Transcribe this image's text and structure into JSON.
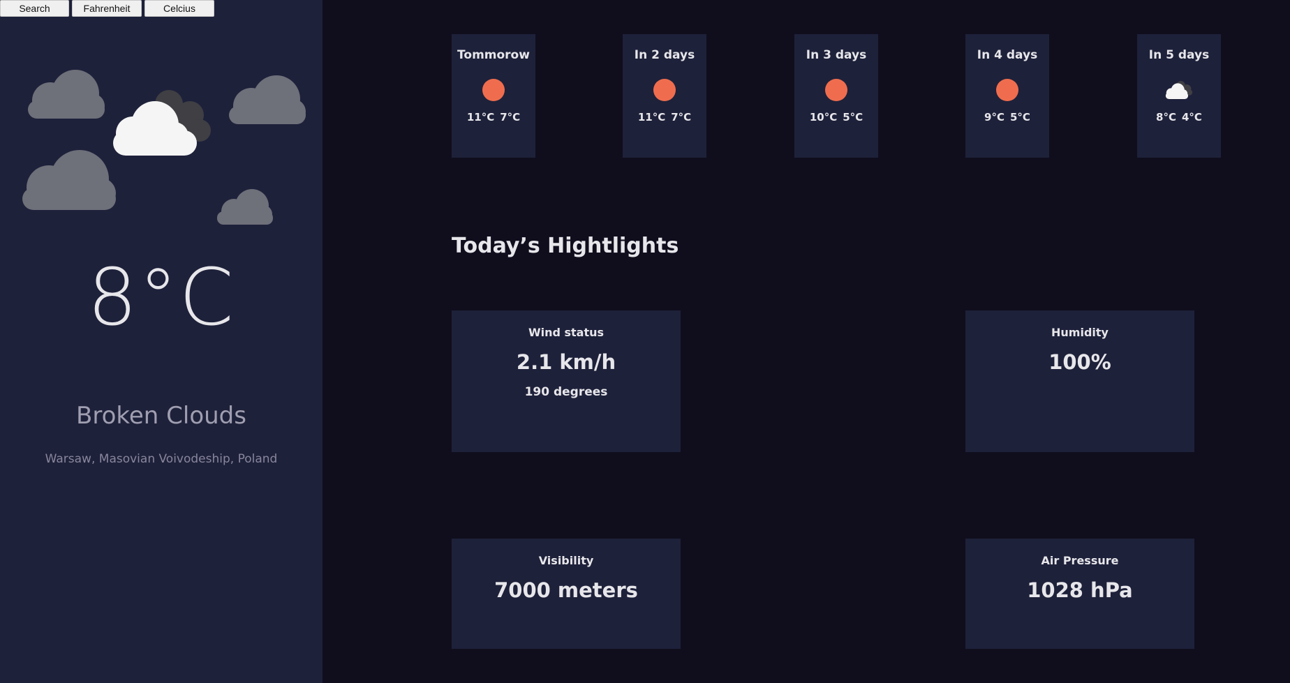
{
  "toolbar": {
    "search_label": "Search",
    "fahrenheit_label": "Fahrenheit",
    "celsius_label": "Celcius"
  },
  "current": {
    "temperature": "8°C",
    "description": "Broken Clouds",
    "location": "Warsaw, Masovian Voivodeship, Poland",
    "icon": "broken-clouds-icon"
  },
  "forecast": [
    {
      "day": "Tommorow",
      "max": "11°C",
      "min": "7°C",
      "icon": "sun-icon"
    },
    {
      "day": "In 2 days",
      "max": "11°C",
      "min": "7°C",
      "icon": "sun-icon"
    },
    {
      "day": "In 3 days",
      "max": "10°C",
      "min": "5°C",
      "icon": "sun-icon"
    },
    {
      "day": "In 4 days",
      "max": "9°C",
      "min": "5°C",
      "icon": "sun-icon"
    },
    {
      "day": "In 5 days",
      "max": "8°C",
      "min": "4°C",
      "icon": "cloud-icon"
    }
  ],
  "highlights": {
    "title": "Today’s Hightlights",
    "wind": {
      "label": "Wind status",
      "value": "2.1 km/h",
      "direction": "190 degrees"
    },
    "humidity": {
      "label": "Humidity",
      "value": "100%"
    },
    "visibility": {
      "label": "Visibility",
      "value": "7000 meters"
    },
    "pressure": {
      "label": "Air Pressure",
      "value": "1028 hPa"
    }
  },
  "colors": {
    "background": "#100e1d",
    "panel": "#1e213a",
    "sun": "#ef6d4e",
    "text": "#e7e7eb",
    "muted": "#a09fb1"
  }
}
